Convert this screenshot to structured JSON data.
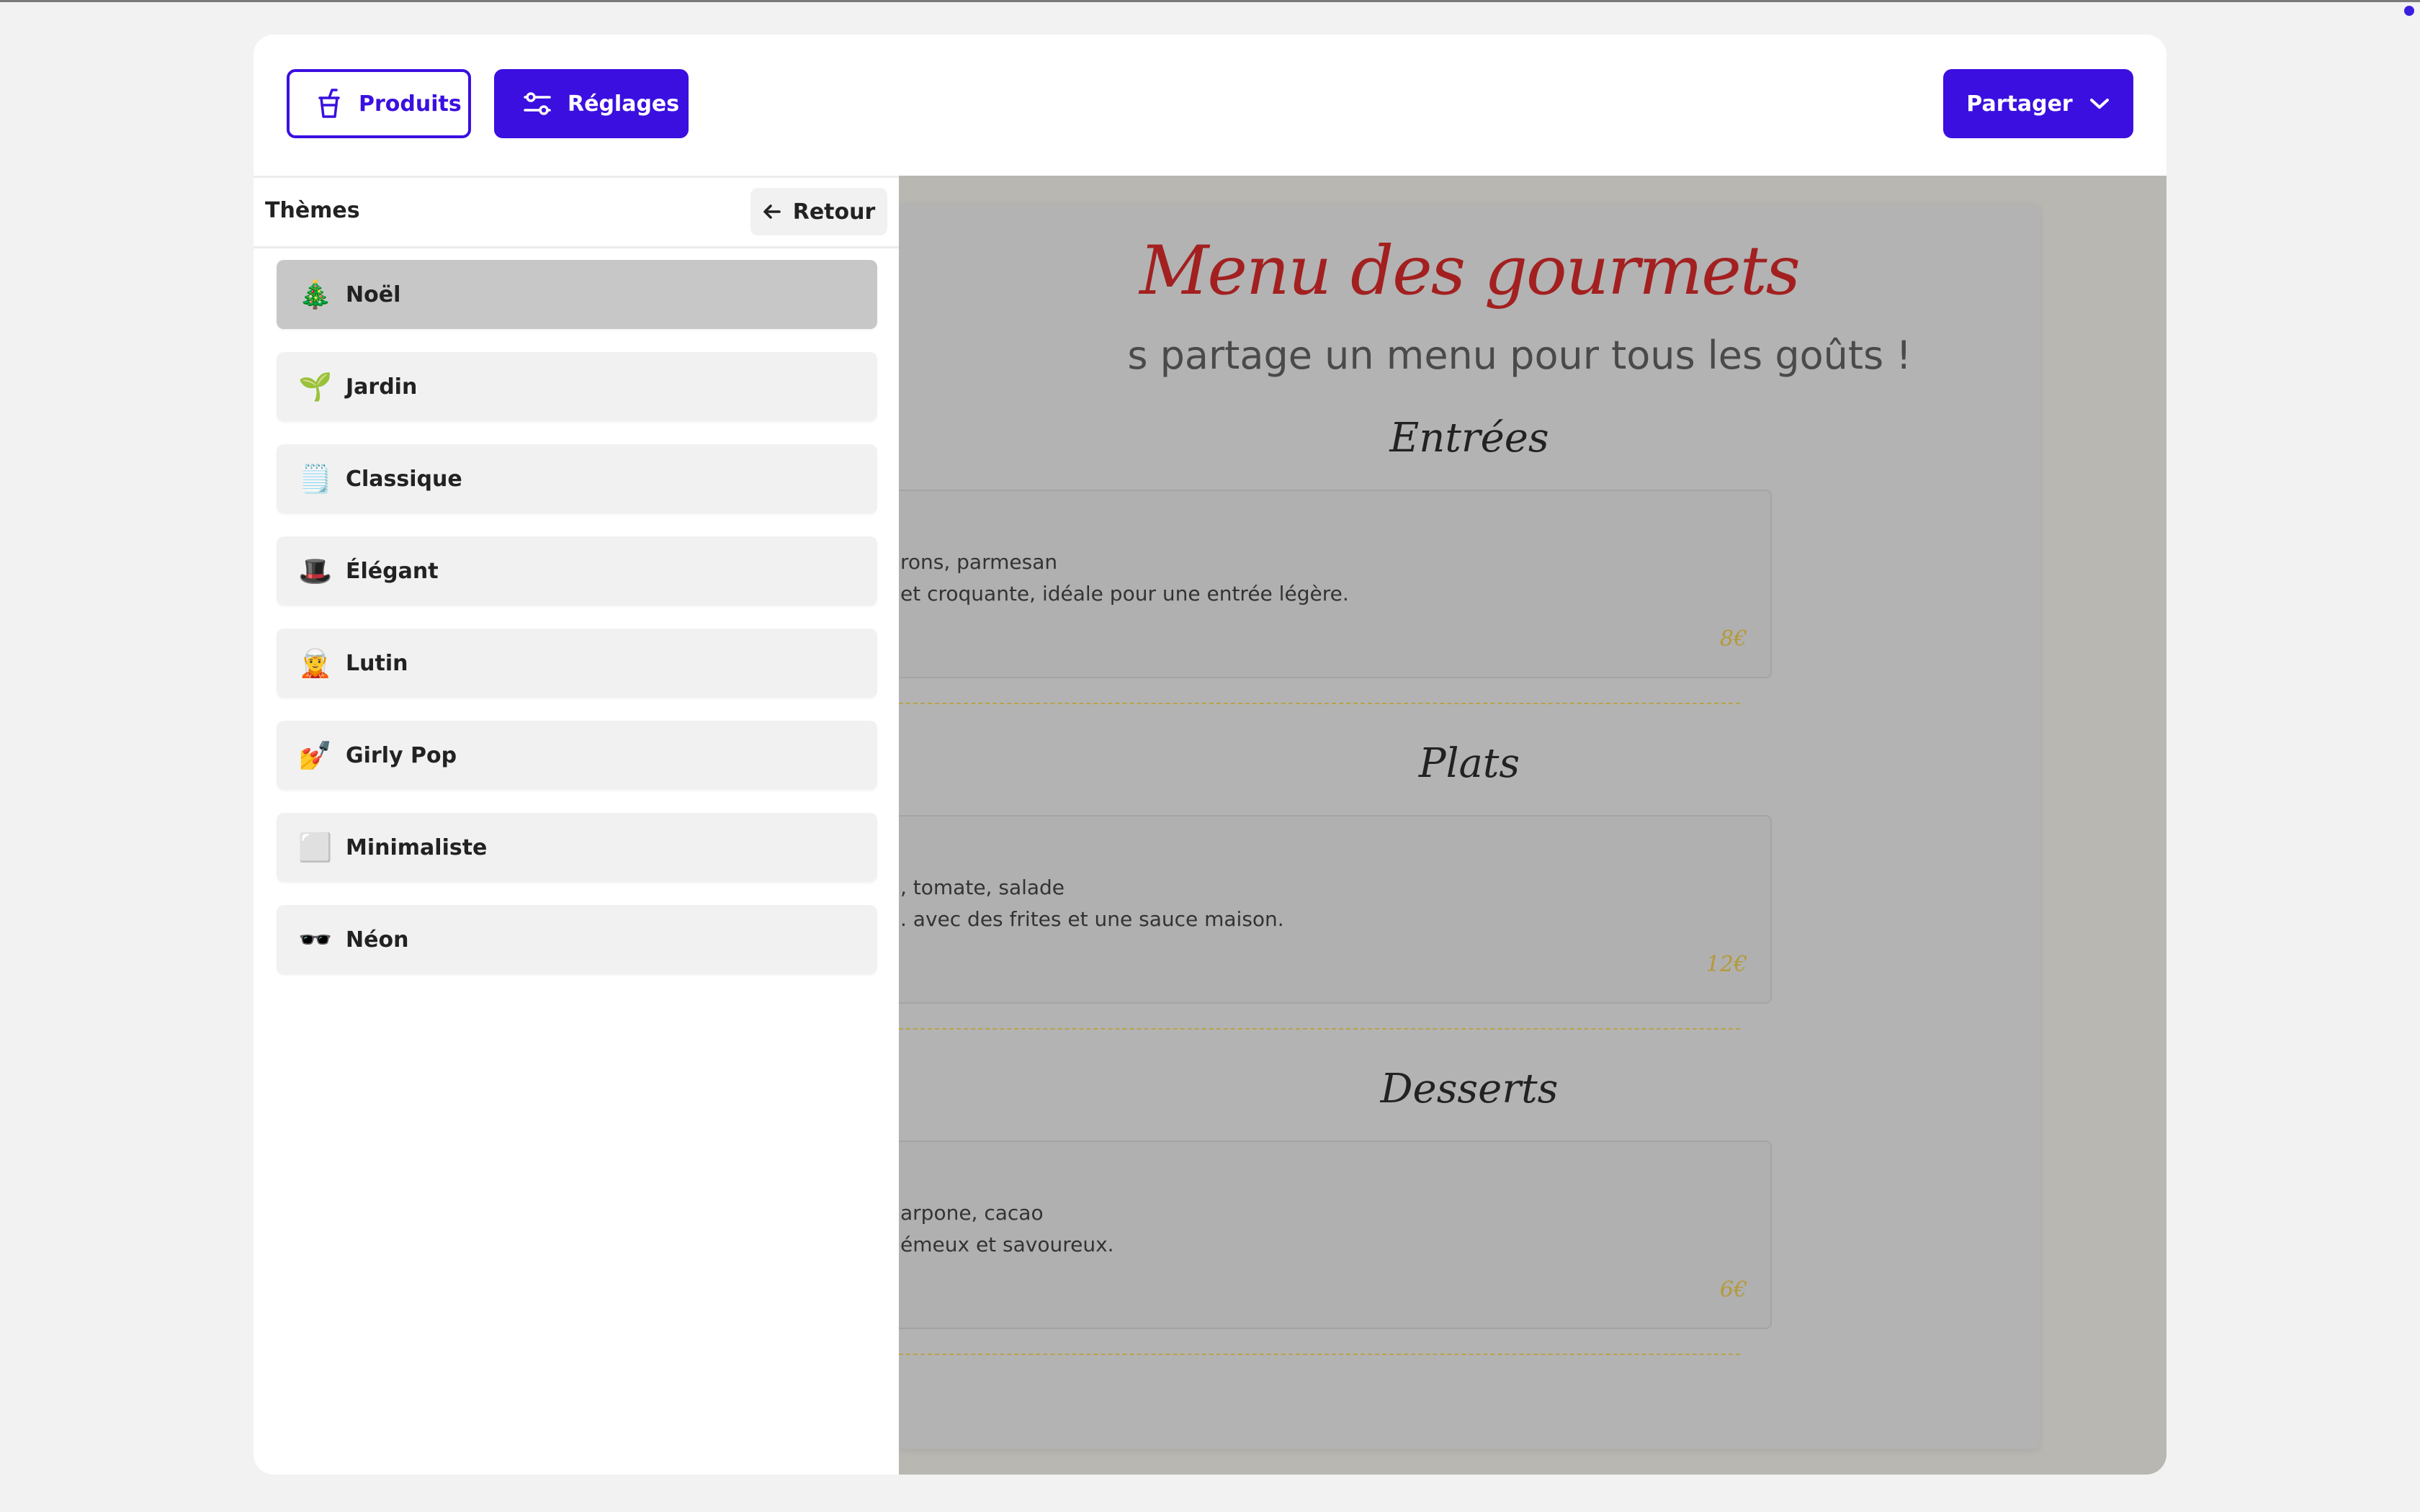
{
  "toolbar": {
    "products_label": "Produits",
    "settings_label": "Réglages",
    "share_label": "Partager"
  },
  "panel": {
    "title": "Thèmes",
    "back_label": "Retour",
    "themes": [
      {
        "emoji": "🎄",
        "label": "Noël",
        "selected": true
      },
      {
        "emoji": "🌱",
        "label": "Jardin"
      },
      {
        "emoji": "🗒️",
        "label": "Classique"
      },
      {
        "emoji": "🎩",
        "label": "Élégant"
      },
      {
        "emoji": "🧝",
        "label": "Lutin"
      },
      {
        "emoji": "💅",
        "label": "Girly Pop"
      },
      {
        "emoji": "⬜",
        "label": "Minimaliste"
      },
      {
        "emoji": "🕶️",
        "label": "Néon"
      }
    ]
  },
  "menu": {
    "title": "Menu des gourmets",
    "subtitle": "s partage un menu pour tous les goûts !",
    "sections": [
      {
        "title": "Entrées",
        "line1": "rons, parmesan",
        "line2": "et croquante, idéale pour une entrée légère.",
        "price": "8€"
      },
      {
        "title": "Plats",
        "line1": ", tomate, salade",
        "line2": ". avec des frites et une sauce maison.",
        "price": "12€"
      },
      {
        "title": "Desserts",
        "line1": "arpone, cacao",
        "line2": "émeux et savoureux.",
        "price": "6€"
      }
    ]
  },
  "colors": {
    "accent": "#3b0fe0",
    "menu_title": "#a32020",
    "price": "#b49a3a"
  },
  "icons": {
    "products": "cup-icon",
    "settings": "sliders-icon",
    "share": "chevron-down-icon",
    "back": "arrow-left-icon"
  }
}
